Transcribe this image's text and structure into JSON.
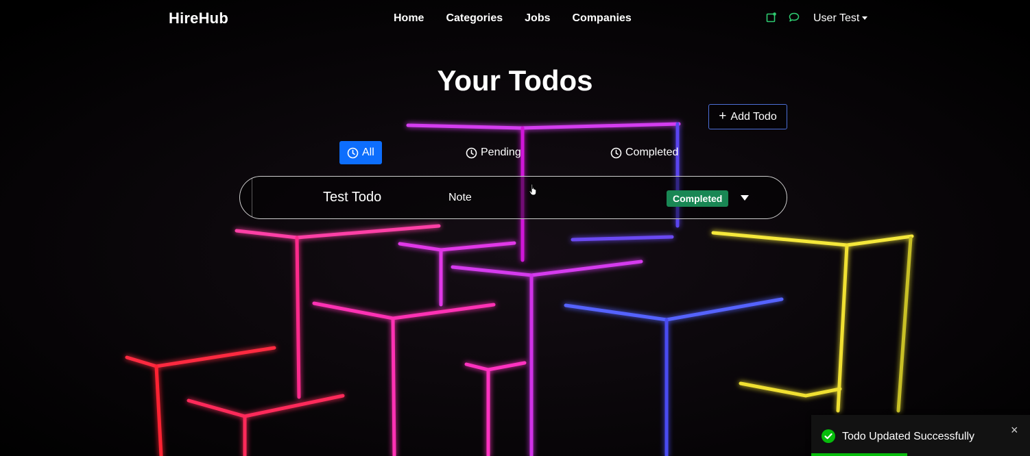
{
  "navbar": {
    "brand": "HireHub",
    "links": [
      "Home",
      "Categories",
      "Jobs",
      "Companies"
    ],
    "icons": [
      "notification-icon",
      "chat-icon"
    ],
    "icon_color": "#2ecc71",
    "user": "User Test"
  },
  "page": {
    "title": "Your Todos",
    "add_button": "Add Todo"
  },
  "filters": [
    {
      "label": "All",
      "active": true
    },
    {
      "label": "Pending",
      "active": false
    },
    {
      "label": "Completed",
      "active": false
    }
  ],
  "todos": [
    {
      "title": "Test Todo",
      "note": "Note",
      "status": "Completed",
      "status_color": "#198754"
    }
  ],
  "toast": {
    "message": "Todo Updated Successfully",
    "close": "×",
    "accent": "#07bc0c",
    "progress": 0.44
  },
  "colors": {
    "primary": "#0d6efd",
    "success": "#198754"
  }
}
